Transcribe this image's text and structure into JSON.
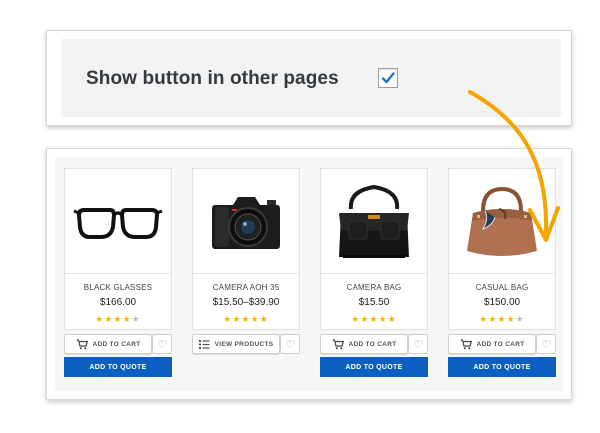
{
  "settings": {
    "label": "Show button in other pages",
    "checked": true
  },
  "products": [
    {
      "name": "BLACK GLASSES",
      "price": "$166.00",
      "rating": 4,
      "image": "glasses-icon",
      "primary_button": "ADD TO CART",
      "primary_icon": "cart-icon",
      "quote_button": "ADD TO QUOTE",
      "has_quote": true
    },
    {
      "name": "CAMERA AOH 35",
      "price": "$15.50–$39.90",
      "rating": 5,
      "image": "camera-icon",
      "primary_button": "VIEW PRODUCTS",
      "primary_icon": "list-icon",
      "has_quote": false
    },
    {
      "name": "CAMERA BAG",
      "price": "$15.50",
      "rating": 5,
      "image": "camera-bag-icon",
      "primary_button": "ADD TO CART",
      "primary_icon": "cart-icon",
      "quote_button": "ADD TO QUOTE",
      "has_quote": true
    },
    {
      "name": "CASUAL BAG",
      "price": "$150.00",
      "rating": 4,
      "image": "handbag-icon",
      "primary_button": "ADD TO CART",
      "primary_icon": "cart-icon",
      "quote_button": "ADD TO QUOTE",
      "has_quote": true
    }
  ],
  "colors": {
    "quote_button": "#0b5fc1",
    "arrow": "#f5a400",
    "star": "#f2b600",
    "checkmark": "#1e73be"
  }
}
